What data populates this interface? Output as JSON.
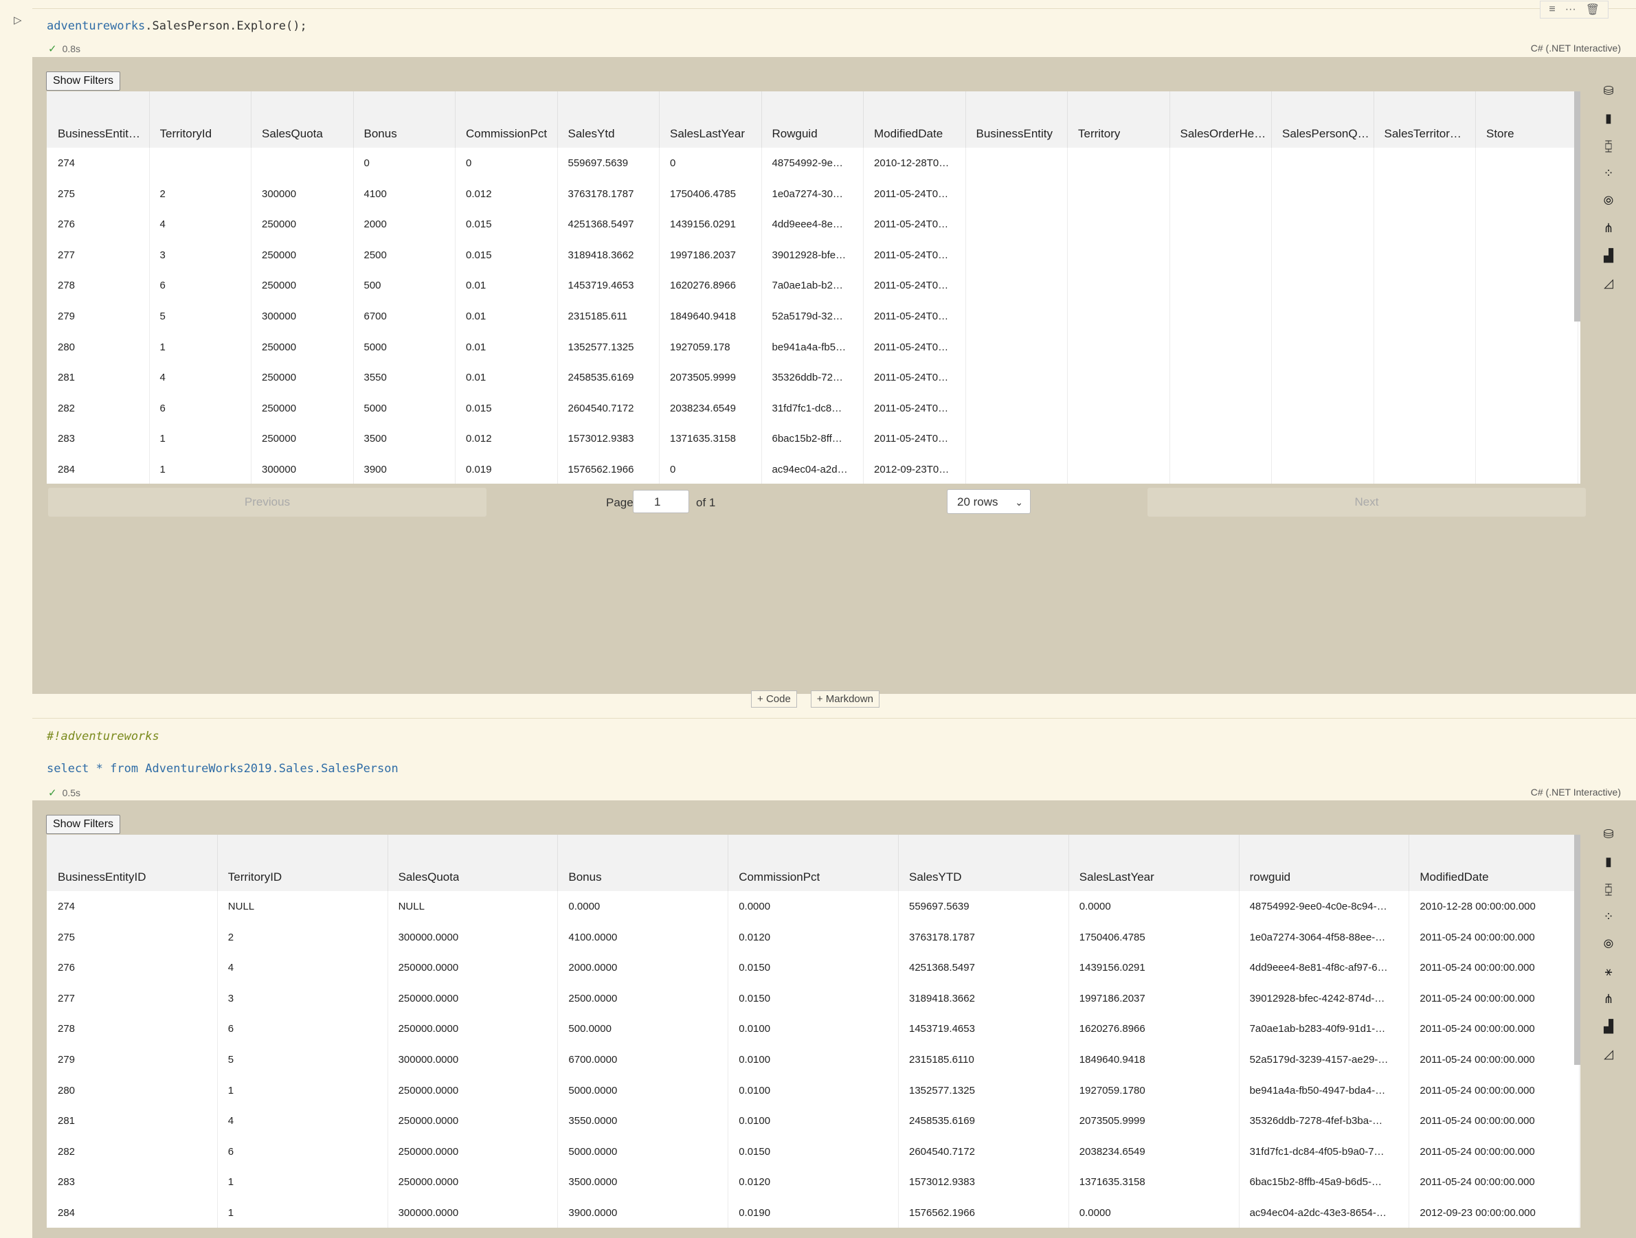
{
  "cell1": {
    "code_object": "adventureworks",
    "code_rest": ".SalesPerson.Explore();",
    "time": "0.8s",
    "kernel": "C# (.NET Interactive)",
    "show_filters": "Show Filters",
    "columns": [
      "BusinessEntit…",
      "TerritoryId",
      "SalesQuota",
      "Bonus",
      "CommissionPct",
      "SalesYtd",
      "SalesLastYear",
      "Rowguid",
      "ModifiedDate",
      "BusinessEntity",
      "Territory",
      "SalesOrderHe…",
      "SalesPersonQ…",
      "SalesTerritor…",
      "Store"
    ],
    "rows": [
      [
        "274",
        "",
        "",
        "0",
        "0",
        "559697.5639",
        "0",
        "48754992-9e…",
        "2010-12-28T0…",
        "",
        "",
        "",
        "",
        "",
        ""
      ],
      [
        "275",
        "2",
        "300000",
        "4100",
        "0.012",
        "3763178.1787",
        "1750406.4785",
        "1e0a7274-30…",
        "2011-05-24T0…",
        "",
        "",
        "",
        "",
        "",
        ""
      ],
      [
        "276",
        "4",
        "250000",
        "2000",
        "0.015",
        "4251368.5497",
        "1439156.0291",
        "4dd9eee4-8e…",
        "2011-05-24T0…",
        "",
        "",
        "",
        "",
        "",
        ""
      ],
      [
        "277",
        "3",
        "250000",
        "2500",
        "0.015",
        "3189418.3662",
        "1997186.2037",
        "39012928-bfe…",
        "2011-05-24T0…",
        "",
        "",
        "",
        "",
        "",
        ""
      ],
      [
        "278",
        "6",
        "250000",
        "500",
        "0.01",
        "1453719.4653",
        "1620276.8966",
        "7a0ae1ab-b2…",
        "2011-05-24T0…",
        "",
        "",
        "",
        "",
        "",
        ""
      ],
      [
        "279",
        "5",
        "300000",
        "6700",
        "0.01",
        "2315185.611",
        "1849640.9418",
        "52a5179d-32…",
        "2011-05-24T0…",
        "",
        "",
        "",
        "",
        "",
        ""
      ],
      [
        "280",
        "1",
        "250000",
        "5000",
        "0.01",
        "1352577.1325",
        "1927059.178",
        "be941a4a-fb5…",
        "2011-05-24T0…",
        "",
        "",
        "",
        "",
        "",
        ""
      ],
      [
        "281",
        "4",
        "250000",
        "3550",
        "0.01",
        "2458535.6169",
        "2073505.9999",
        "35326ddb-72…",
        "2011-05-24T0…",
        "",
        "",
        "",
        "",
        "",
        ""
      ],
      [
        "282",
        "6",
        "250000",
        "5000",
        "0.015",
        "2604540.7172",
        "2038234.6549",
        "31fd7fc1-dc8…",
        "2011-05-24T0…",
        "",
        "",
        "",
        "",
        "",
        ""
      ],
      [
        "283",
        "1",
        "250000",
        "3500",
        "0.012",
        "1573012.9383",
        "1371635.3158",
        "6bac15b2-8ff…",
        "2011-05-24T0…",
        "",
        "",
        "",
        "",
        "",
        ""
      ],
      [
        "284",
        "1",
        "300000",
        "3900",
        "0.019",
        "1576562.1966",
        "0",
        "ac94ec04-a2d…",
        "2012-09-23T0…",
        "",
        "",
        "",
        "",
        "",
        ""
      ]
    ],
    "pager": {
      "previous": "Previous",
      "page_label": "Page",
      "page_value": "1",
      "of": "of 1",
      "rows": "20 rows",
      "next": "Next"
    }
  },
  "add": {
    "code": "Code",
    "markdown": "Markdown"
  },
  "cell2": {
    "magic": "#!adventureworks",
    "sql": "select * from AdventureWorks2019.Sales.SalesPerson",
    "time": "0.5s",
    "kernel": "C# (.NET Interactive)",
    "show_filters": "Show Filters",
    "columns": [
      "BusinessEntityID",
      "TerritoryID",
      "SalesQuota",
      "Bonus",
      "CommissionPct",
      "SalesYTD",
      "SalesLastYear",
      "rowguid",
      "ModifiedDate"
    ],
    "rows": [
      [
        "274",
        "NULL",
        "NULL",
        "0.0000",
        "0.0000",
        "559697.5639",
        "0.0000",
        "48754992-9ee0-4c0e-8c94-…",
        "2010-12-28 00:00:00.000"
      ],
      [
        "275",
        "2",
        "300000.0000",
        "4100.0000",
        "0.0120",
        "3763178.1787",
        "1750406.4785",
        "1e0a7274-3064-4f58-88ee-…",
        "2011-05-24 00:00:00.000"
      ],
      [
        "276",
        "4",
        "250000.0000",
        "2000.0000",
        "0.0150",
        "4251368.5497",
        "1439156.0291",
        "4dd9eee4-8e81-4f8c-af97-6…",
        "2011-05-24 00:00:00.000"
      ],
      [
        "277",
        "3",
        "250000.0000",
        "2500.0000",
        "0.0150",
        "3189418.3662",
        "1997186.2037",
        "39012928-bfec-4242-874d-…",
        "2011-05-24 00:00:00.000"
      ],
      [
        "278",
        "6",
        "250000.0000",
        "500.0000",
        "0.0100",
        "1453719.4653",
        "1620276.8966",
        "7a0ae1ab-b283-40f9-91d1-…",
        "2011-05-24 00:00:00.000"
      ],
      [
        "279",
        "5",
        "300000.0000",
        "6700.0000",
        "0.0100",
        "2315185.6110",
        "1849640.9418",
        "52a5179d-3239-4157-ae29-…",
        "2011-05-24 00:00:00.000"
      ],
      [
        "280",
        "1",
        "250000.0000",
        "5000.0000",
        "0.0100",
        "1352577.1325",
        "1927059.1780",
        "be941a4a-fb50-4947-bda4-…",
        "2011-05-24 00:00:00.000"
      ],
      [
        "281",
        "4",
        "250000.0000",
        "3550.0000",
        "0.0100",
        "2458535.6169",
        "2073505.9999",
        "35326ddb-7278-4fef-b3ba-…",
        "2011-05-24 00:00:00.000"
      ],
      [
        "282",
        "6",
        "250000.0000",
        "5000.0000",
        "0.0150",
        "2604540.7172",
        "2038234.6549",
        "31fd7fc1-dc84-4f05-b9a0-7…",
        "2011-05-24 00:00:00.000"
      ],
      [
        "283",
        "1",
        "250000.0000",
        "3500.0000",
        "0.0120",
        "1573012.9383",
        "1371635.3158",
        "6bac15b2-8ffb-45a9-b6d5-…",
        "2011-05-24 00:00:00.000"
      ],
      [
        "284",
        "1",
        "300000.0000",
        "3900.0000",
        "0.0190",
        "1576562.1966",
        "0.0000",
        "ac94ec04-a2dc-43e3-8654-…",
        "2012-09-23 00:00:00.000"
      ]
    ]
  },
  "icons": {
    "side": [
      "database-icon",
      "bar-chart-icon",
      "candlestick-icon",
      "scatter-icon",
      "bubble-icon",
      "tree-icon",
      "line-bars-icon",
      "area-chart-icon"
    ],
    "side2": [
      "database-icon",
      "bar-chart-icon",
      "candlestick-icon",
      "scatter-icon",
      "bubble-icon",
      "network-icon",
      "tree-icon",
      "line-bars-icon",
      "area-chart-icon"
    ]
  }
}
